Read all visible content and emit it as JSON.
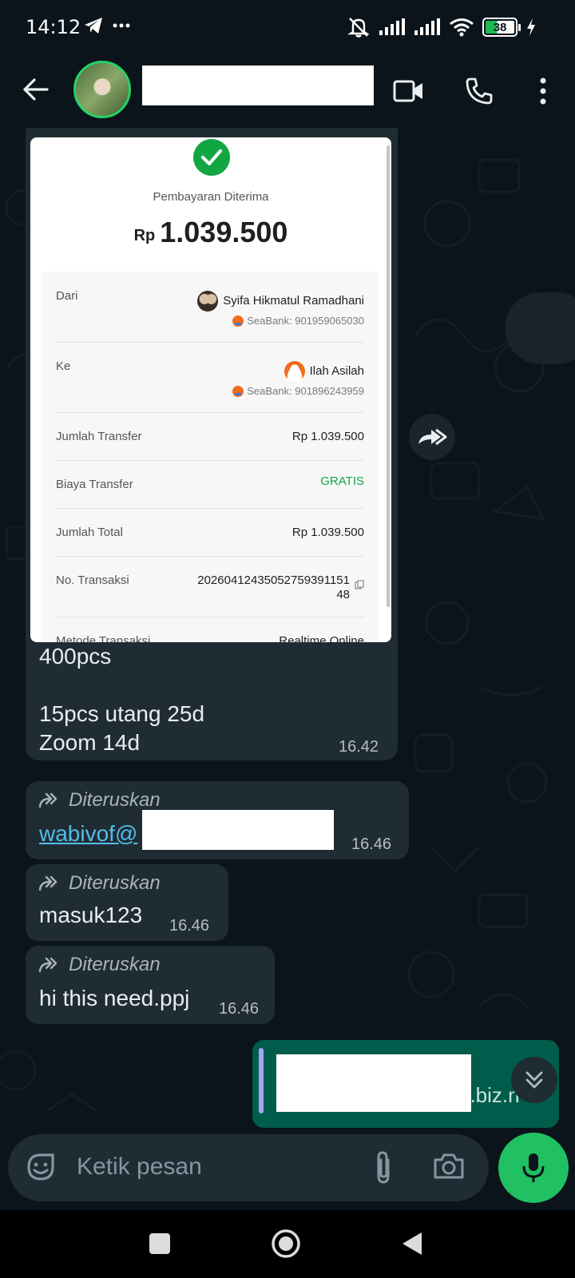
{
  "status_bar": {
    "time": "14:12",
    "battery": "38"
  },
  "header": {
    "contact_name_redacted": true
  },
  "receipt": {
    "title": "Pembayaran Diterima",
    "currency": "Rp",
    "amount": "1.039.500",
    "from_label": "Dari",
    "from_name": "Syifa Hikmatul Ramadhani",
    "from_bank": "SeaBank: 901959065030",
    "to_label": "Ke",
    "to_name": "Ilah Asilah",
    "to_bank": "SeaBank: 901896243959",
    "rows": [
      {
        "label": "Jumlah Transfer",
        "value": "Rp 1.039.500"
      },
      {
        "label": "Biaya Transfer",
        "value": "GRATIS"
      },
      {
        "label": "Jumlah Total",
        "value": "Rp 1.039.500"
      }
    ],
    "txn_label": "No. Transaksi",
    "txn_value": "2026041243505275939115148",
    "txn_line1": "20260412435052759391151",
    "txn_line2": "48",
    "method_label": "Metode Transaksi",
    "method_value": "Realtime Online"
  },
  "messages": {
    "first": {
      "text": "400pcs\n\n15pcs utang 25d\nZoom 14d",
      "time": "16.42"
    },
    "second": {
      "forwarded_label": "Diteruskan",
      "link_text": "wabivof@",
      "time": "16.46"
    },
    "third": {
      "forwarded_label": "Diteruskan",
      "text": "masuk123",
      "time": "16.46"
    },
    "fourth": {
      "forwarded_label": "Diteruskan",
      "text": "hi this need.ppj",
      "time": "16.46"
    },
    "outgoing": {
      "partial_text": "n.biz.n"
    }
  },
  "input": {
    "placeholder": "Ketik pesan"
  },
  "colors": {
    "background": "#0b141a",
    "incoming_bubble": "#202c33",
    "outgoing_bubble": "#005c4b",
    "accent_green": "#21c063",
    "link": "#53bdeb",
    "gratis": "#12a642"
  },
  "icons": {
    "back": "arrow-left-icon",
    "video": "video-camera-icon",
    "call": "phone-icon",
    "menu": "more-vertical-icon",
    "forward": "forward-arrow-icon",
    "sticker": "sticker-icon",
    "attach": "paperclip-icon",
    "camera": "camera-icon",
    "mic": "microphone-icon"
  }
}
